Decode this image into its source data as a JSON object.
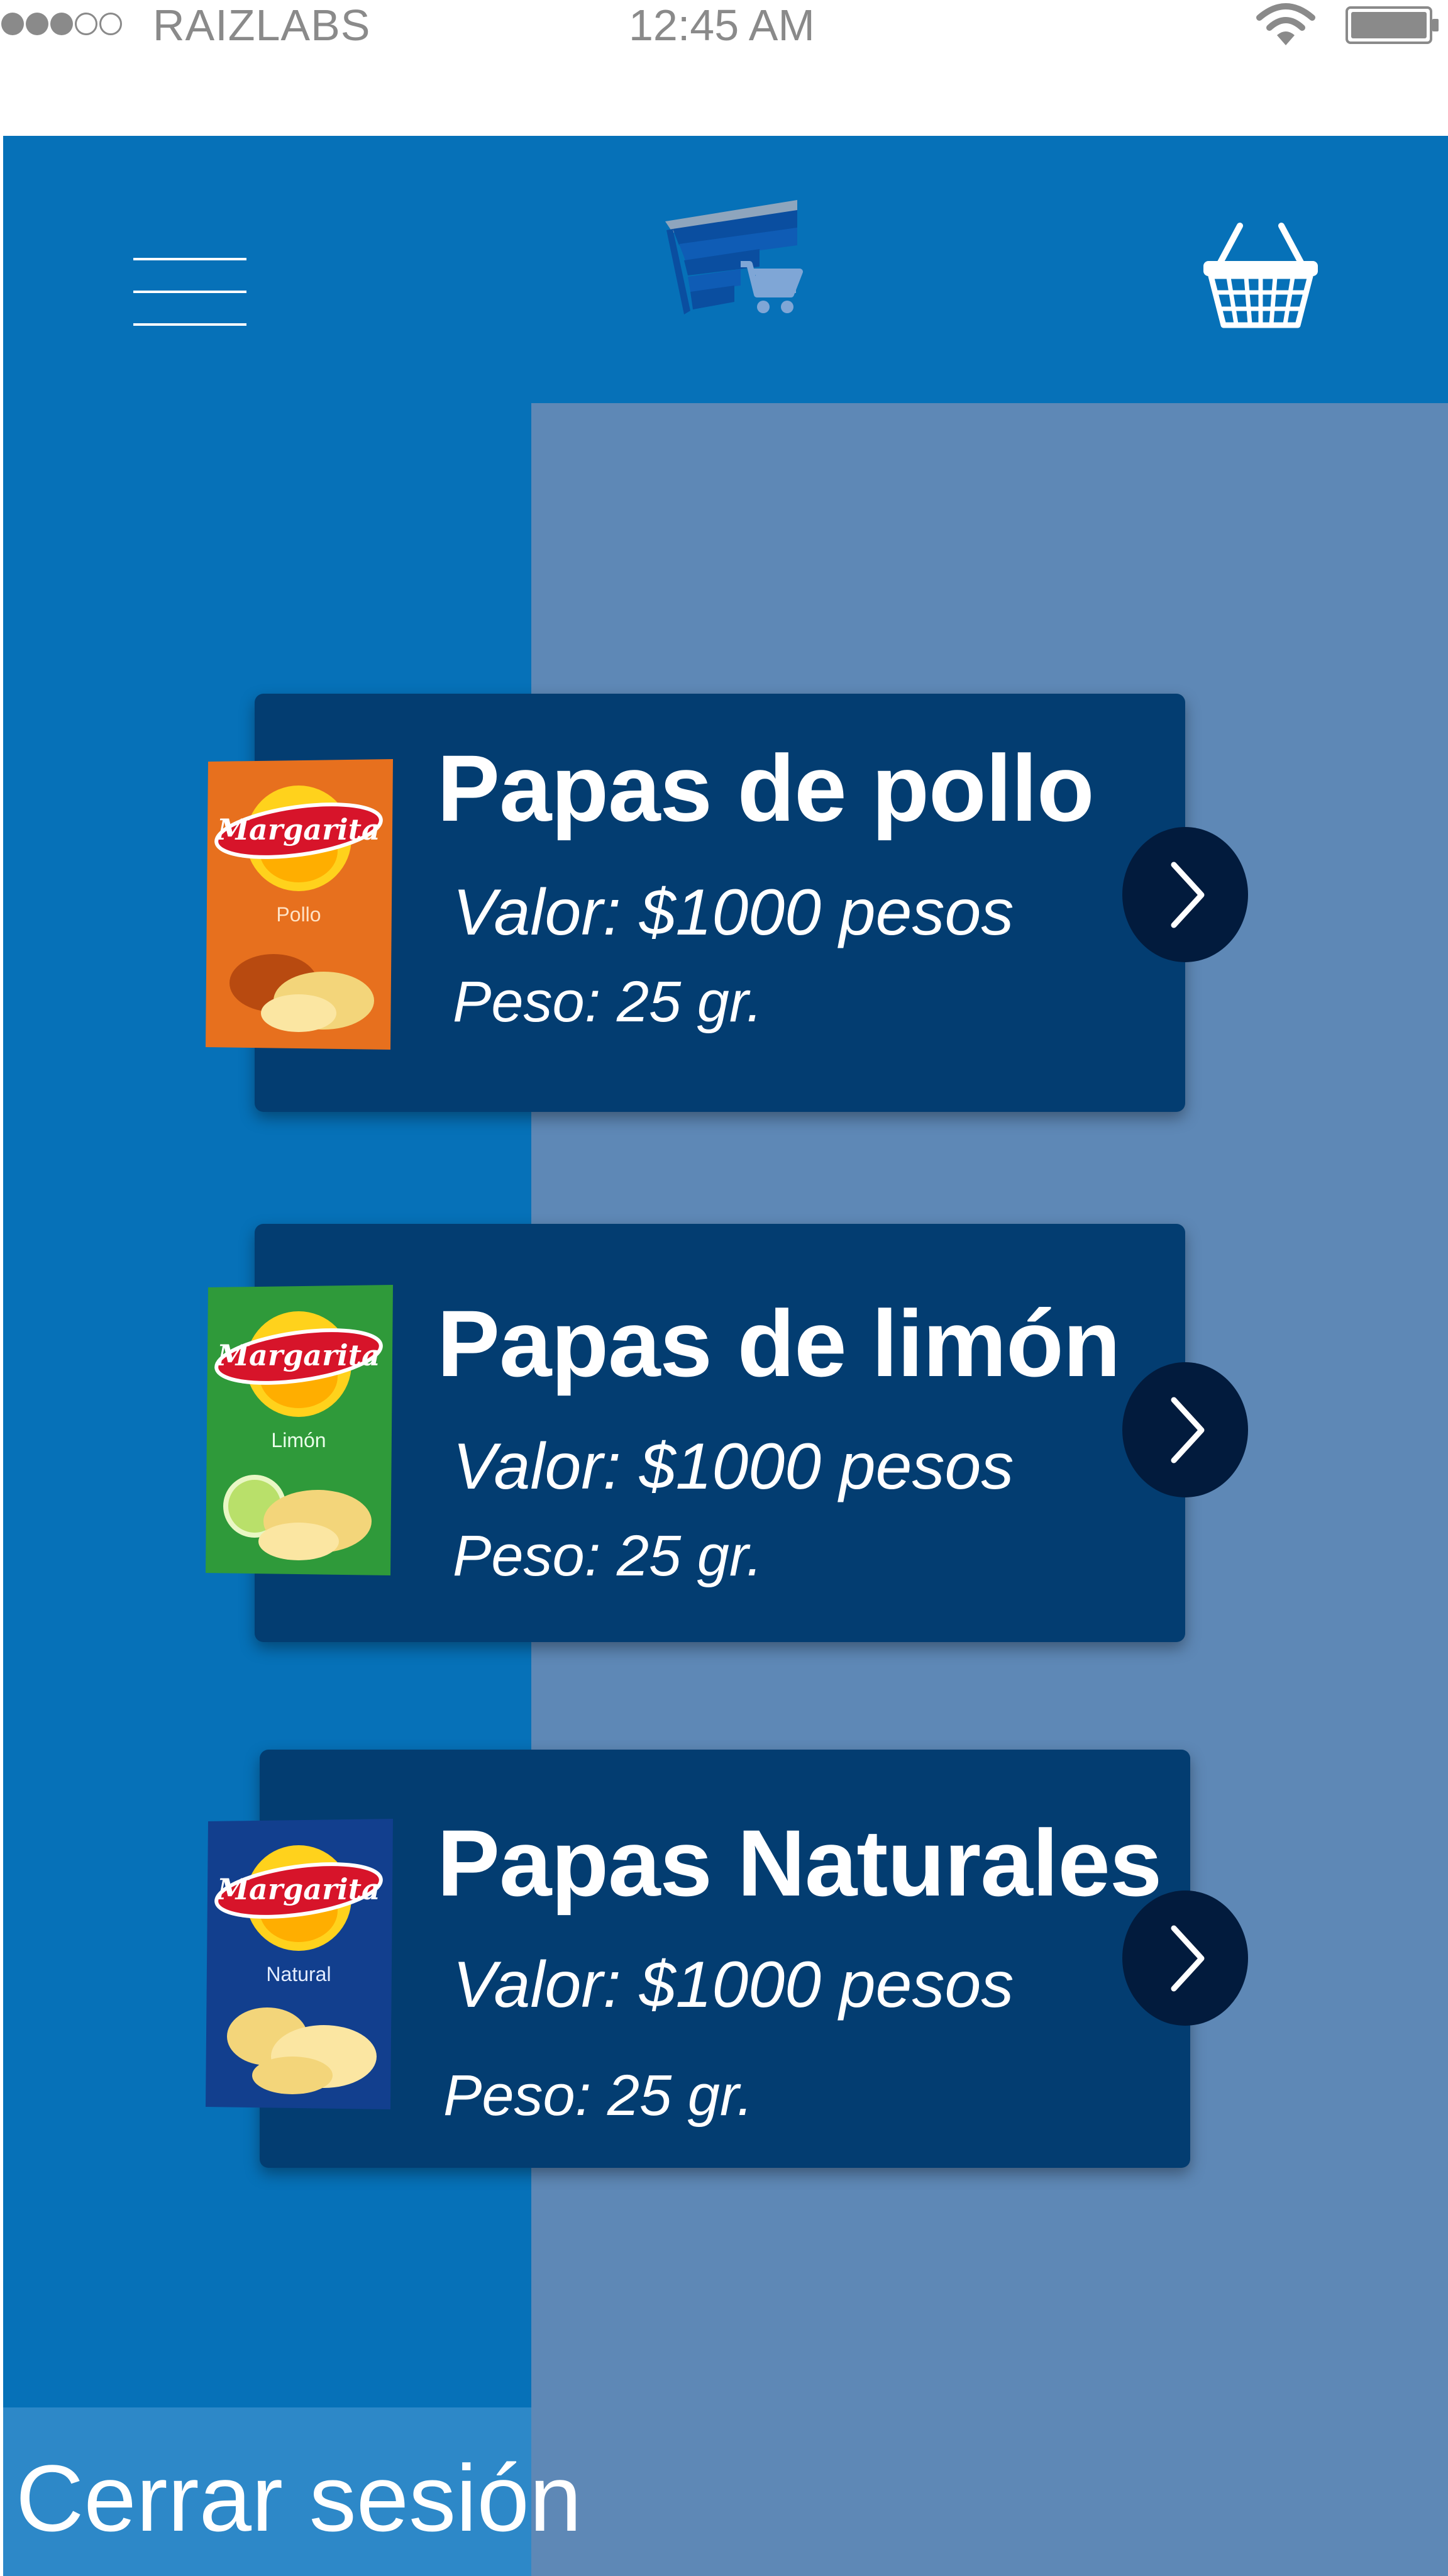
{
  "status_bar": {
    "signal_dots_filled": 3,
    "signal_dots_total": 5,
    "carrier": "RAIZLABS",
    "time": "12:45 AM",
    "wifi_icon": "wifi-icon",
    "battery_icon": "battery-icon"
  },
  "header": {
    "menu_icon": "hamburger-menu-icon",
    "logo_icon": "store-cart-logo-icon",
    "cart_icon": "basket-icon"
  },
  "products": [
    {
      "name": "Papas de pollo",
      "price": "Valor: $1000  pesos",
      "weight": "Peso: 25 gr.",
      "bag_brand": "Margarita",
      "bag_flavor": "Pollo",
      "bag_color": "#e7701e"
    },
    {
      "name": "Papas de limón",
      "price": "Valor: $1000  pesos",
      "weight": "Peso: 25 gr.",
      "bag_brand": "Margarita",
      "bag_flavor": "Limón",
      "bag_color": "#2f9a3a"
    },
    {
      "name": "Papas Naturales",
      "price": "Valor: $1000  pesos",
      "weight": "Peso: 25 gr.",
      "bag_brand": "Margarita",
      "bag_flavor": "Natural",
      "bag_color": "#123f8e"
    }
  ],
  "logout_label": "Cerrar sesión",
  "colors": {
    "primary_blue": "#0671b8",
    "panel_blue": "#5e88b6",
    "card_navy": "#033d71",
    "arrow_button": "#021b3d",
    "logout_bg": "#2d88c8"
  }
}
